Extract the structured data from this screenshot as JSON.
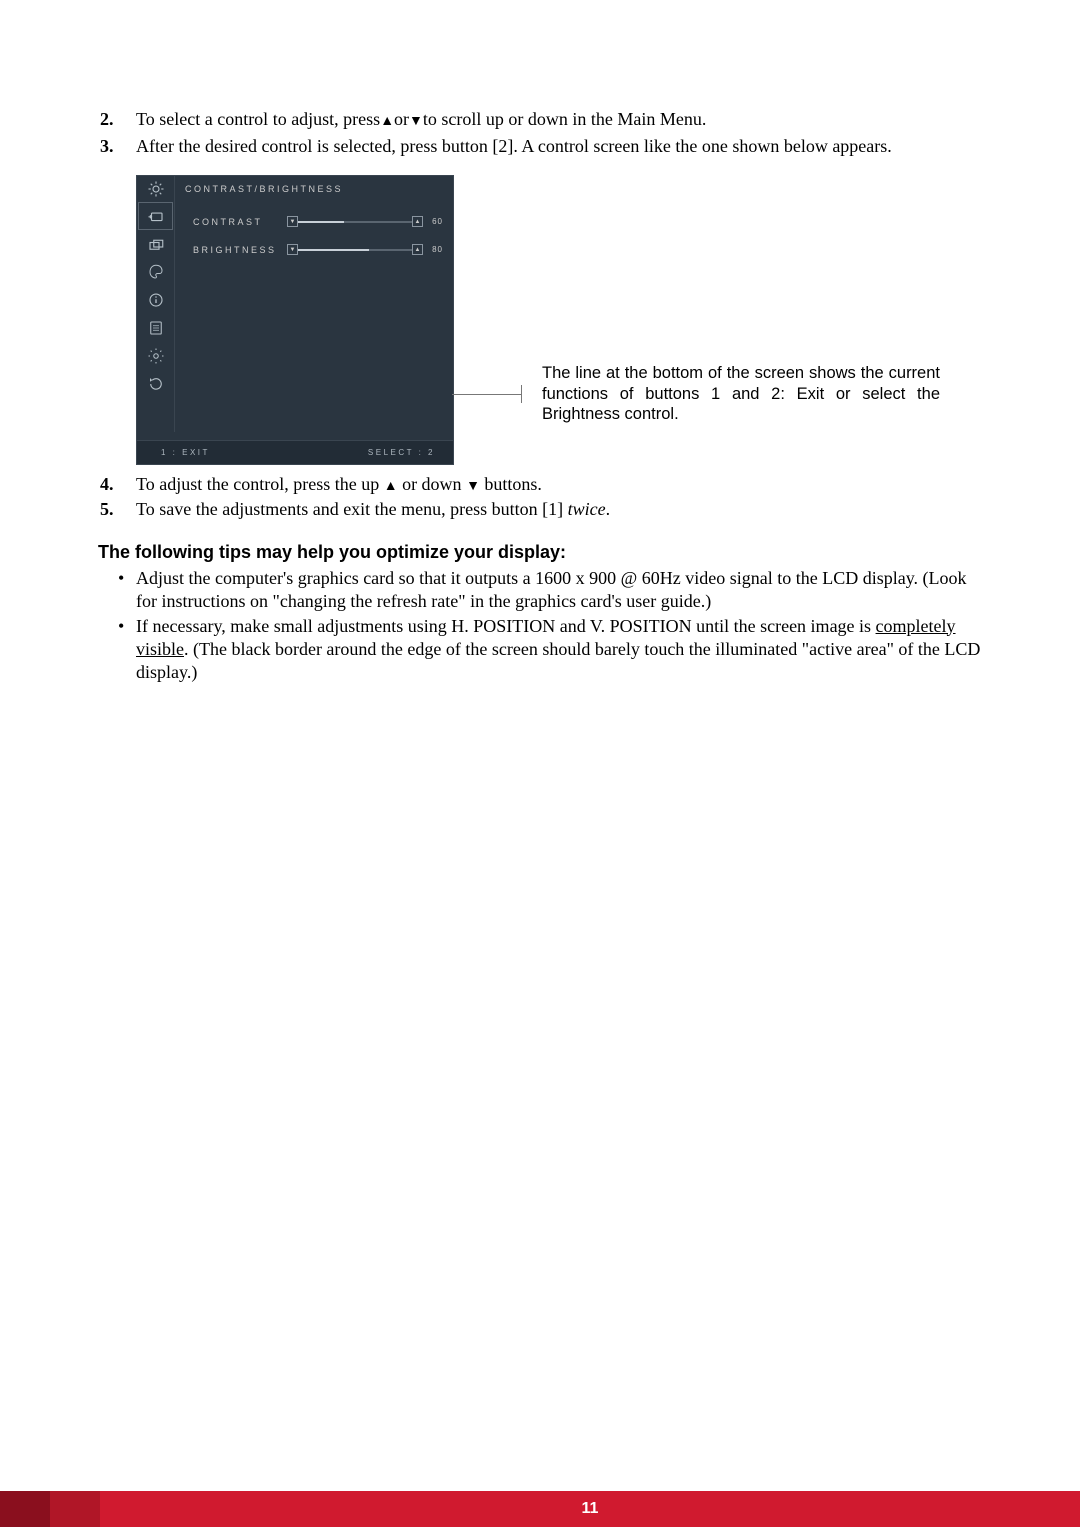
{
  "steps_a": [
    {
      "num": "2.",
      "text_pre": "To select a control to adjust, press",
      "text_mid": "or",
      "text_post": "to scroll up or down in the Main Menu."
    },
    {
      "num": "3.",
      "text": "After the desired control is selected, press button [2]. A control screen like the one shown below appears."
    }
  ],
  "osd": {
    "title": "CONTRAST/BRIGHTNESS",
    "rows": [
      {
        "label": "CONTRAST",
        "value": "60",
        "fill_pct": 40
      },
      {
        "label": "BRIGHTNESS",
        "value": "80",
        "fill_pct": 62
      }
    ],
    "foot_left": "1 : EXIT",
    "foot_right": "SELECT : 2"
  },
  "callout": "The line at the bottom of the screen shows the current functions of buttons 1 and 2: Exit or select the Brightness control.",
  "steps_b": [
    {
      "num": "4.",
      "pre": "To adjust the control, press the up ",
      "mid": " or down ",
      "post": " buttons."
    },
    {
      "num": "5.",
      "pre": "To save the adjustments and exit the menu, press button [1] ",
      "ital": "twice",
      "post2": "."
    }
  ],
  "tips_heading": "The following tips may help you optimize your display:",
  "tips": [
    "Adjust the computer's graphics card so that it outputs a 1600 x 900 @ 60Hz video signal to the LCD display. (Look for instructions on \"changing the refresh rate\" in the graphics card's user guide.)",
    {
      "pre": "If necessary, make small adjustments using H. POSITION and V. POSITION until the screen image is ",
      "ul": "completely visible",
      "post": ". (The black border around the edge of the screen should barely touch the illuminated \"active area\" of the LCD display.)"
    }
  ],
  "page_number": "11",
  "glyphs": {
    "up": "▲",
    "down": "▼"
  }
}
